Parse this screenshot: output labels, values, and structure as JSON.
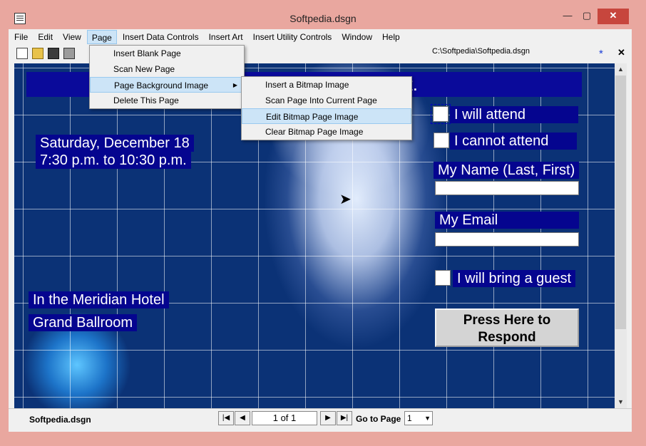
{
  "window": {
    "title": "Softpedia.dsgn",
    "min": "—",
    "max": "▢",
    "close": "✕"
  },
  "menubar": [
    "File",
    "Edit",
    "View",
    "Page",
    "Insert Data Controls",
    "Insert Art",
    "Insert Utility Controls",
    "Window",
    "Help"
  ],
  "toolbar": {
    "path": "C:\\Softpedia\\Softpedia.dsgn",
    "star": "*",
    "close": "✕"
  },
  "page_menu": [
    {
      "label": "Insert Blank Page"
    },
    {
      "label": "Scan New Page"
    },
    {
      "label": "Page Background Image"
    },
    {
      "label": "Delete This Page"
    }
  ],
  "submenu": [
    {
      "label": "Insert a Bitmap Image"
    },
    {
      "label": "Scan Page Into Current Page"
    },
    {
      "label": "Edit Bitmap Page Image"
    },
    {
      "label": "Clear Bitmap Page Image"
    }
  ],
  "canvas": {
    "banner_text": "t.",
    "date_line1": "Saturday, December 18",
    "date_line2": "7:30 p.m. to 10:30 p.m.",
    "venue_line1": "In the Meridian Hotel",
    "venue_line2": "Grand Ballroom",
    "attend": "I will attend",
    "not_attend": "I cannot attend",
    "name_label": "My Name (Last, First)",
    "email_label": "My Email",
    "guest": "I will bring a guest",
    "respond_line1": "Press Here to",
    "respond_line2": "Respond"
  },
  "scrollbar": {
    "up": "▲",
    "down": "▼"
  },
  "status": {
    "filename": "Softpedia.dsgn",
    "first": "|◀",
    "prev": "◀",
    "next": "▶",
    "last": "▶|",
    "page": "1 of 1",
    "goto_label": "Go to Page",
    "goto_value": "1"
  }
}
